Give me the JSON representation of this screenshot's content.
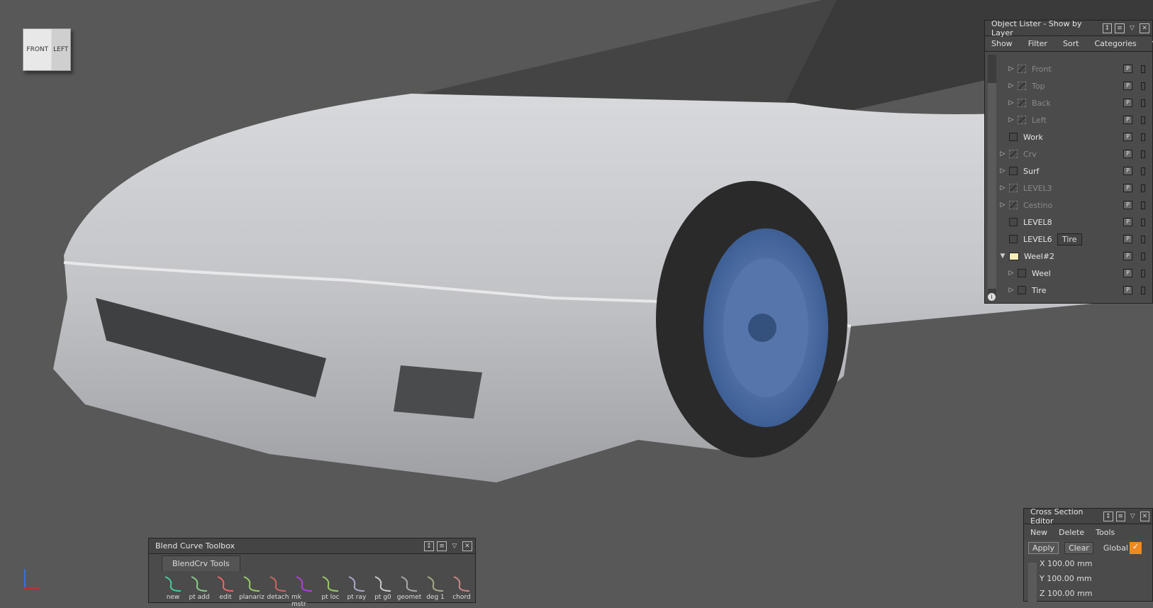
{
  "viewcube": {
    "front": "FRONT",
    "left": "LEFT"
  },
  "object_lister": {
    "title": "Object Lister - Show by Layer",
    "menu": [
      "Show",
      "Filter",
      "Sort",
      "Categories"
    ],
    "rows": [
      {
        "label": "Front",
        "indent": 2,
        "expand": true,
        "dim": true,
        "type": "hatch"
      },
      {
        "label": "Top",
        "indent": 2,
        "expand": true,
        "dim": true,
        "type": "hatch"
      },
      {
        "label": "Back",
        "indent": 2,
        "expand": true,
        "dim": true,
        "type": "hatch"
      },
      {
        "label": "Left",
        "indent": 2,
        "expand": true,
        "dim": true,
        "type": "hatch"
      },
      {
        "label": "Work",
        "indent": 1,
        "expand": false,
        "dim": false,
        "type": "box"
      },
      {
        "label": "Crv",
        "indent": 1,
        "expand": true,
        "dim": true,
        "type": "hatch"
      },
      {
        "label": "Surf",
        "indent": 1,
        "expand": true,
        "dim": false,
        "type": "box"
      },
      {
        "label": "LEVEL3",
        "indent": 1,
        "expand": true,
        "dim": true,
        "type": "hatch"
      },
      {
        "label": "Cestino",
        "indent": 1,
        "expand": true,
        "dim": true,
        "type": "hatch"
      },
      {
        "label": "LEVEL8",
        "indent": 1,
        "expand": false,
        "dim": false,
        "type": "box"
      },
      {
        "label": "LEVEL6",
        "indent": 1,
        "expand": false,
        "dim": false,
        "type": "box"
      },
      {
        "label": "Weel#2",
        "indent": 1,
        "expand": "open",
        "dim": false,
        "type": "folder"
      },
      {
        "label": "Weel",
        "indent": 2,
        "expand": true,
        "dim": false,
        "type": "box"
      },
      {
        "label": "Tire",
        "indent": 2,
        "expand": true,
        "dim": false,
        "type": "box"
      }
    ],
    "p_label": "P",
    "tooltip": "Tire"
  },
  "blend_toolbox": {
    "title": "Blend Curve Toolbox",
    "tab": "BlendCrv Tools",
    "tools": [
      "new",
      "pt add",
      "edit",
      "planariz",
      "detach",
      "mk mstr",
      "pt loc",
      "pt ray",
      "pt g0",
      "geomet",
      "deg 1",
      "chord"
    ]
  },
  "cross_section": {
    "title": "Cross Section Editor",
    "menu": [
      "New",
      "Delete",
      "Tools"
    ],
    "apply": "Apply",
    "clear": "Clear",
    "global": "Global",
    "accent": "#f08a1e",
    "coords": [
      "X 100.00 mm",
      "Y 100.00 mm",
      "Z 100.00 mm"
    ]
  }
}
